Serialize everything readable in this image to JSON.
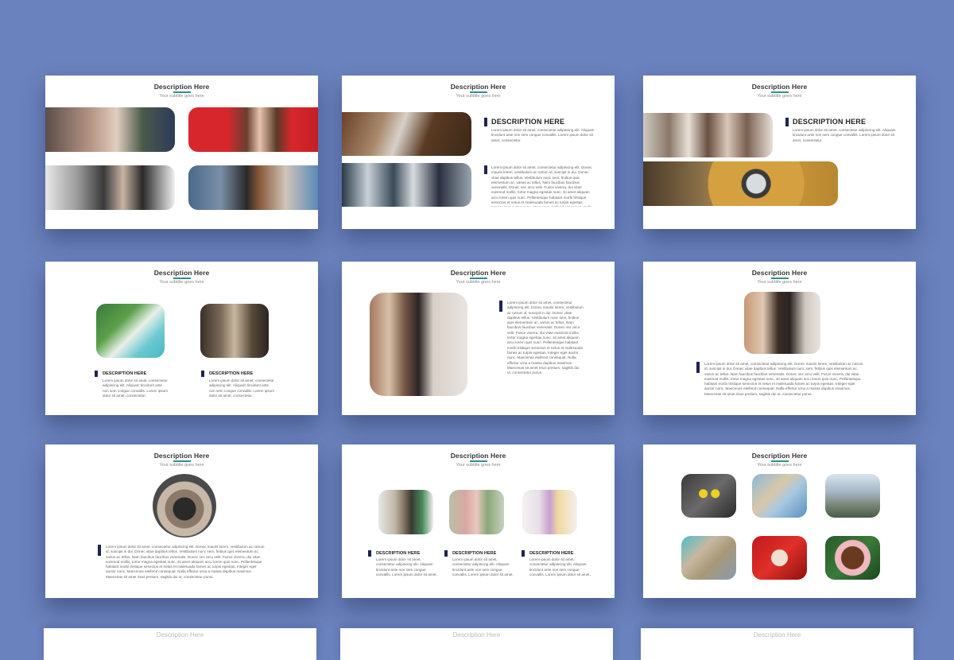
{
  "slide_title": "Description Here",
  "slide_subtitle": "Your subtitle goes here",
  "heading_large": "DESCRIPTION HERE",
  "heading_small": "DESCRIPTION HERE",
  "para_short": "Lorem ipsum dolor sit amet, consectetur adipiscing elit. Aliquam tincidunt ante non sem congue convallis. Lorem ipsum dolor sit amet, consectetur.",
  "para_long": "Lorem ipsum dolor sit amet, consectetur adipiscing elit. Donec mauris lorem, vestibulum ac rutrum id, suscipit in dui. Donec vitae dapibus tellus. Vestibulum nunc sem, finibus quis elementum ac, varius ac tellus. Nam faucibus faucibus venenatis. Donec nec arcu velit. Fusce viverra, dui vitae euismod mollis, tortor magna egestas nunc, sit amet aliquam arcu lorem quis nunc. Pellentesque habitant morbi tristique senectus et netus et malesuada fames ac turpis egestas. Integer eget auctor nunc. Maecenas eleifend consequat. Nulla efficitur urna a massa dapibus maximus. Maecenas sit amet risus pretium, sagittis dui ut, consectetur purus."
}
